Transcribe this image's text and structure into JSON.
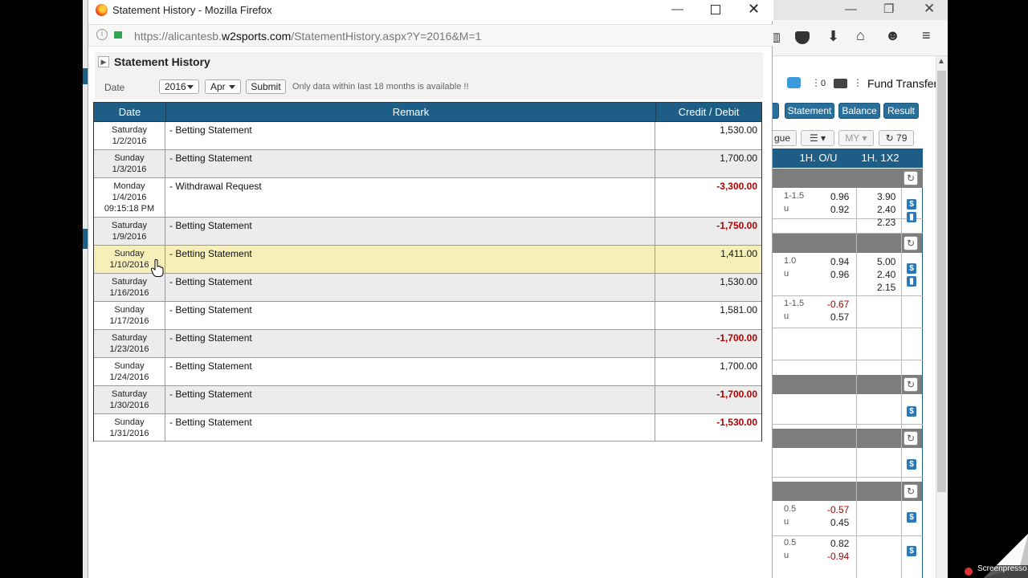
{
  "popup": {
    "title": "Statement History - Mozilla Firefox",
    "url_prefix": "https://alicantesb.",
    "url_domain": "w2sports.com",
    "url_path": "/StatementHistory.aspx?Y=2016&M=1"
  },
  "panel": {
    "title": "Statement History",
    "date_label": "Date",
    "year": "2016",
    "month": "Apr",
    "submit": "Submit",
    "note": "Only data within last 18 months is available !!"
  },
  "table": {
    "headers": [
      "Date",
      "Remark",
      "Credit / Debit"
    ],
    "rows": [
      {
        "day": "Saturday",
        "date": "1/2/2016",
        "time": "",
        "remark": "- Betting Statement",
        "amount": "1,530.00",
        "negative": false
      },
      {
        "day": "Sunday",
        "date": "1/3/2016",
        "time": "",
        "remark": "- Betting Statement",
        "amount": "1,700.00",
        "negative": false
      },
      {
        "day": "Monday",
        "date": "1/4/2016",
        "time": "09:15:18 PM",
        "remark": "- Withdrawal Request",
        "amount": "-3,300.00",
        "negative": true
      },
      {
        "day": "Saturday",
        "date": "1/9/2016",
        "time": "",
        "remark": "- Betting Statement",
        "amount": "-1,750.00",
        "negative": true
      },
      {
        "day": "Sunday",
        "date": "1/10/2016",
        "time": "",
        "remark": "- Betting Statement",
        "amount": "1,411.00",
        "negative": false
      },
      {
        "day": "Saturday",
        "date": "1/16/2016",
        "time": "",
        "remark": "- Betting Statement",
        "amount": "1,530.00",
        "negative": false
      },
      {
        "day": "Sunday",
        "date": "1/17/2016",
        "time": "",
        "remark": "- Betting Statement",
        "amount": "1,581.00",
        "negative": false
      },
      {
        "day": "Saturday",
        "date": "1/23/2016",
        "time": "",
        "remark": "- Betting Statement",
        "amount": "-1,700.00",
        "negative": true
      },
      {
        "day": "Sunday",
        "date": "1/24/2016",
        "time": "",
        "remark": "- Betting Statement",
        "amount": "1,700.00",
        "negative": false
      },
      {
        "day": "Saturday",
        "date": "1/30/2016",
        "time": "",
        "remark": "- Betting Statement",
        "amount": "-1,700.00",
        "negative": true
      },
      {
        "day": "Sunday",
        "date": "1/31/2016",
        "time": "",
        "remark": "- Betting Statement",
        "amount": "-1,530.00",
        "negative": true
      }
    ],
    "highlighted_row": 4
  },
  "background": {
    "count": "0",
    "fund_transfer": "Fund Transfer",
    "buttons": [
      "Statement",
      "Balance",
      "Result"
    ],
    "league_fragment": "gue",
    "my_label": "MY",
    "refresh_count": "79",
    "col_ou": "1H. O/U",
    "col_1x2": "1H. 1X2",
    "odds": [
      {
        "line": "1-1.5",
        "u": "u",
        "v1": "0.96",
        "v2": "0.92",
        "x1": "3.90",
        "x2": "2.40",
        "x3": "2.23"
      },
      {
        "line": "1.0",
        "u": "u",
        "v1": "0.94",
        "v2": "0.96",
        "x1": "5.00",
        "x2": "2.40",
        "x3": "2.15"
      },
      {
        "line": "1-1.5",
        "u": "u",
        "v1": "-0.67",
        "v2": "0.57"
      },
      {
        "line": "0.5",
        "u": "u",
        "v1": "-0.57",
        "v2": "0.45"
      },
      {
        "line": "0.5",
        "u": "u",
        "v1": "0.82",
        "v2": "-0.94"
      }
    ]
  },
  "watermark": "Screenpresso",
  "colors": {
    "header_blue": "#1e5e86",
    "negative_red": "#b00000",
    "highlight": "#f7efb8"
  }
}
